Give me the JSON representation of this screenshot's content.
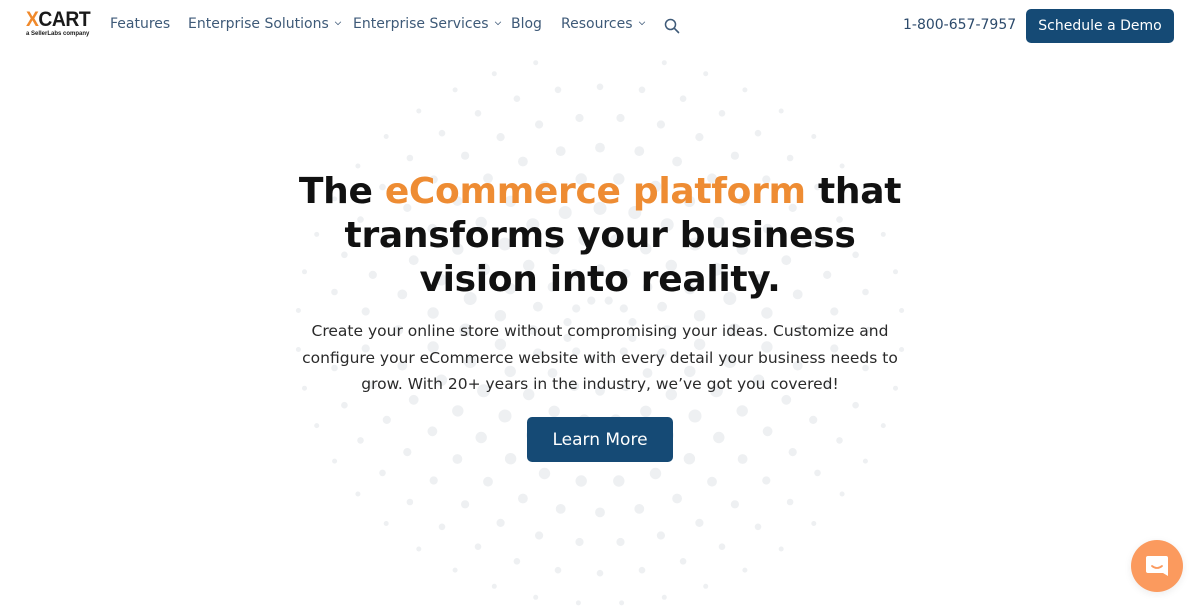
{
  "header": {
    "logo": {
      "main_accent": "X",
      "main_rest": "CART",
      "tagline": "a SellerLabs company"
    },
    "nav": [
      {
        "label": "Features",
        "has_dropdown": false
      },
      {
        "label": "Enterprise Solutions",
        "has_dropdown": true
      },
      {
        "label": "Enterprise Services",
        "has_dropdown": true
      },
      {
        "label": "Blog",
        "has_dropdown": false
      },
      {
        "label": "Resources",
        "has_dropdown": true
      }
    ],
    "search_icon": "search-icon",
    "phone": "1-800-657-7957",
    "cta_label": "Schedule a Demo"
  },
  "hero": {
    "title_prefix": "The ",
    "title_accent": "eCommerce platform",
    "title_line1_suffix": " that",
    "title_line2": "transforms your business",
    "title_line3": "vision into reality.",
    "description": "Create your online store without compromising your ideas. Customize and configure your eCommerce website with every detail your business needs to grow. With 20+ years in the industry, we’ve got you covered!",
    "cta_label": "Learn More"
  },
  "chat_widget": {
    "icon": "chat-icon"
  },
  "colors": {
    "accent_orange": "#ee8c33",
    "brand_navy": "#154a75",
    "nav_text": "#3e5a78",
    "chat_orange": "#fb9a5e"
  }
}
